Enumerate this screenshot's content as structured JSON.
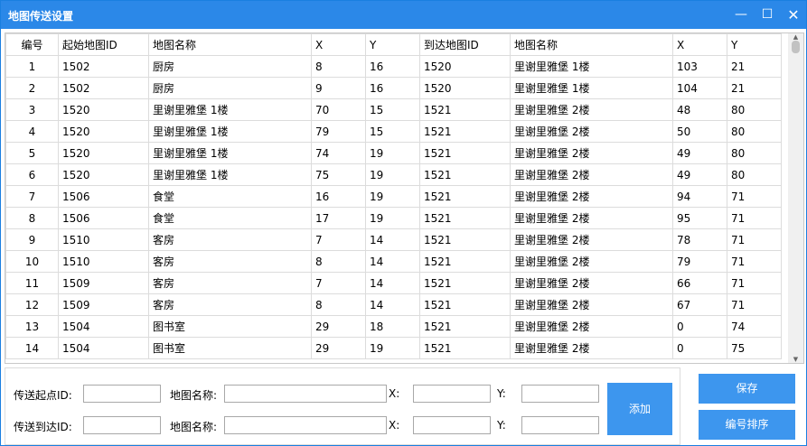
{
  "window": {
    "title": "地图传送设置",
    "min_glyph": "—",
    "max_glyph": "☐",
    "close_glyph": "✕"
  },
  "table": {
    "headers": [
      "编号",
      "起始地图ID",
      "地图名称",
      "X",
      "Y",
      "到达地图ID",
      "地图名称",
      "X",
      "Y"
    ],
    "rows": [
      [
        "1",
        "1502",
        "厨房",
        "8",
        "16",
        "1520",
        "里谢里雅堡 1楼",
        "103",
        "21"
      ],
      [
        "2",
        "1502",
        "厨房",
        "9",
        "16",
        "1520",
        "里谢里雅堡 1楼",
        "104",
        "21"
      ],
      [
        "3",
        "1520",
        "里谢里雅堡 1楼",
        "70",
        "15",
        "1521",
        "里谢里雅堡 2楼",
        "48",
        "80"
      ],
      [
        "4",
        "1520",
        "里谢里雅堡 1楼",
        "79",
        "15",
        "1521",
        "里谢里雅堡 2楼",
        "50",
        "80"
      ],
      [
        "5",
        "1520",
        "里谢里雅堡 1楼",
        "74",
        "19",
        "1521",
        "里谢里雅堡 2楼",
        "49",
        "80"
      ],
      [
        "6",
        "1520",
        "里谢里雅堡 1楼",
        "75",
        "19",
        "1521",
        "里谢里雅堡 2楼",
        "49",
        "80"
      ],
      [
        "7",
        "1506",
        "食堂",
        "16",
        "19",
        "1521",
        "里谢里雅堡 2楼",
        "94",
        "71"
      ],
      [
        "8",
        "1506",
        "食堂",
        "17",
        "19",
        "1521",
        "里谢里雅堡 2楼",
        "95",
        "71"
      ],
      [
        "9",
        "1510",
        "客房",
        "7",
        "14",
        "1521",
        "里谢里雅堡 2楼",
        "78",
        "71"
      ],
      [
        "10",
        "1510",
        "客房",
        "8",
        "14",
        "1521",
        "里谢里雅堡 2楼",
        "79",
        "71"
      ],
      [
        "11",
        "1509",
        "客房",
        "7",
        "14",
        "1521",
        "里谢里雅堡 2楼",
        "66",
        "71"
      ],
      [
        "12",
        "1509",
        "客房",
        "8",
        "14",
        "1521",
        "里谢里雅堡 2楼",
        "67",
        "71"
      ],
      [
        "13",
        "1504",
        "图书室",
        "29",
        "18",
        "1521",
        "里谢里雅堡 2楼",
        "0",
        "74"
      ],
      [
        "14",
        "1504",
        "图书室",
        "29",
        "19",
        "1521",
        "里谢里雅堡 2楼",
        "0",
        "75"
      ]
    ]
  },
  "form": {
    "start_id_label": "传送起点ID:",
    "start_name_label": "地图名称:",
    "start_x_label": "X:",
    "start_y_label": "Y:",
    "dest_id_label": "传送到达ID:",
    "dest_name_label": "地图名称:",
    "dest_x_label": "X:",
    "dest_y_label": "Y:",
    "start_id": "",
    "start_name": "",
    "start_x": "",
    "start_y": "",
    "dest_id": "",
    "dest_name": "",
    "dest_x": "",
    "dest_y": ""
  },
  "buttons": {
    "add": "添加",
    "save": "保存",
    "sort": "编号排序"
  },
  "colors": {
    "titlebar": "#2b88e8",
    "button": "#3d96ee"
  }
}
